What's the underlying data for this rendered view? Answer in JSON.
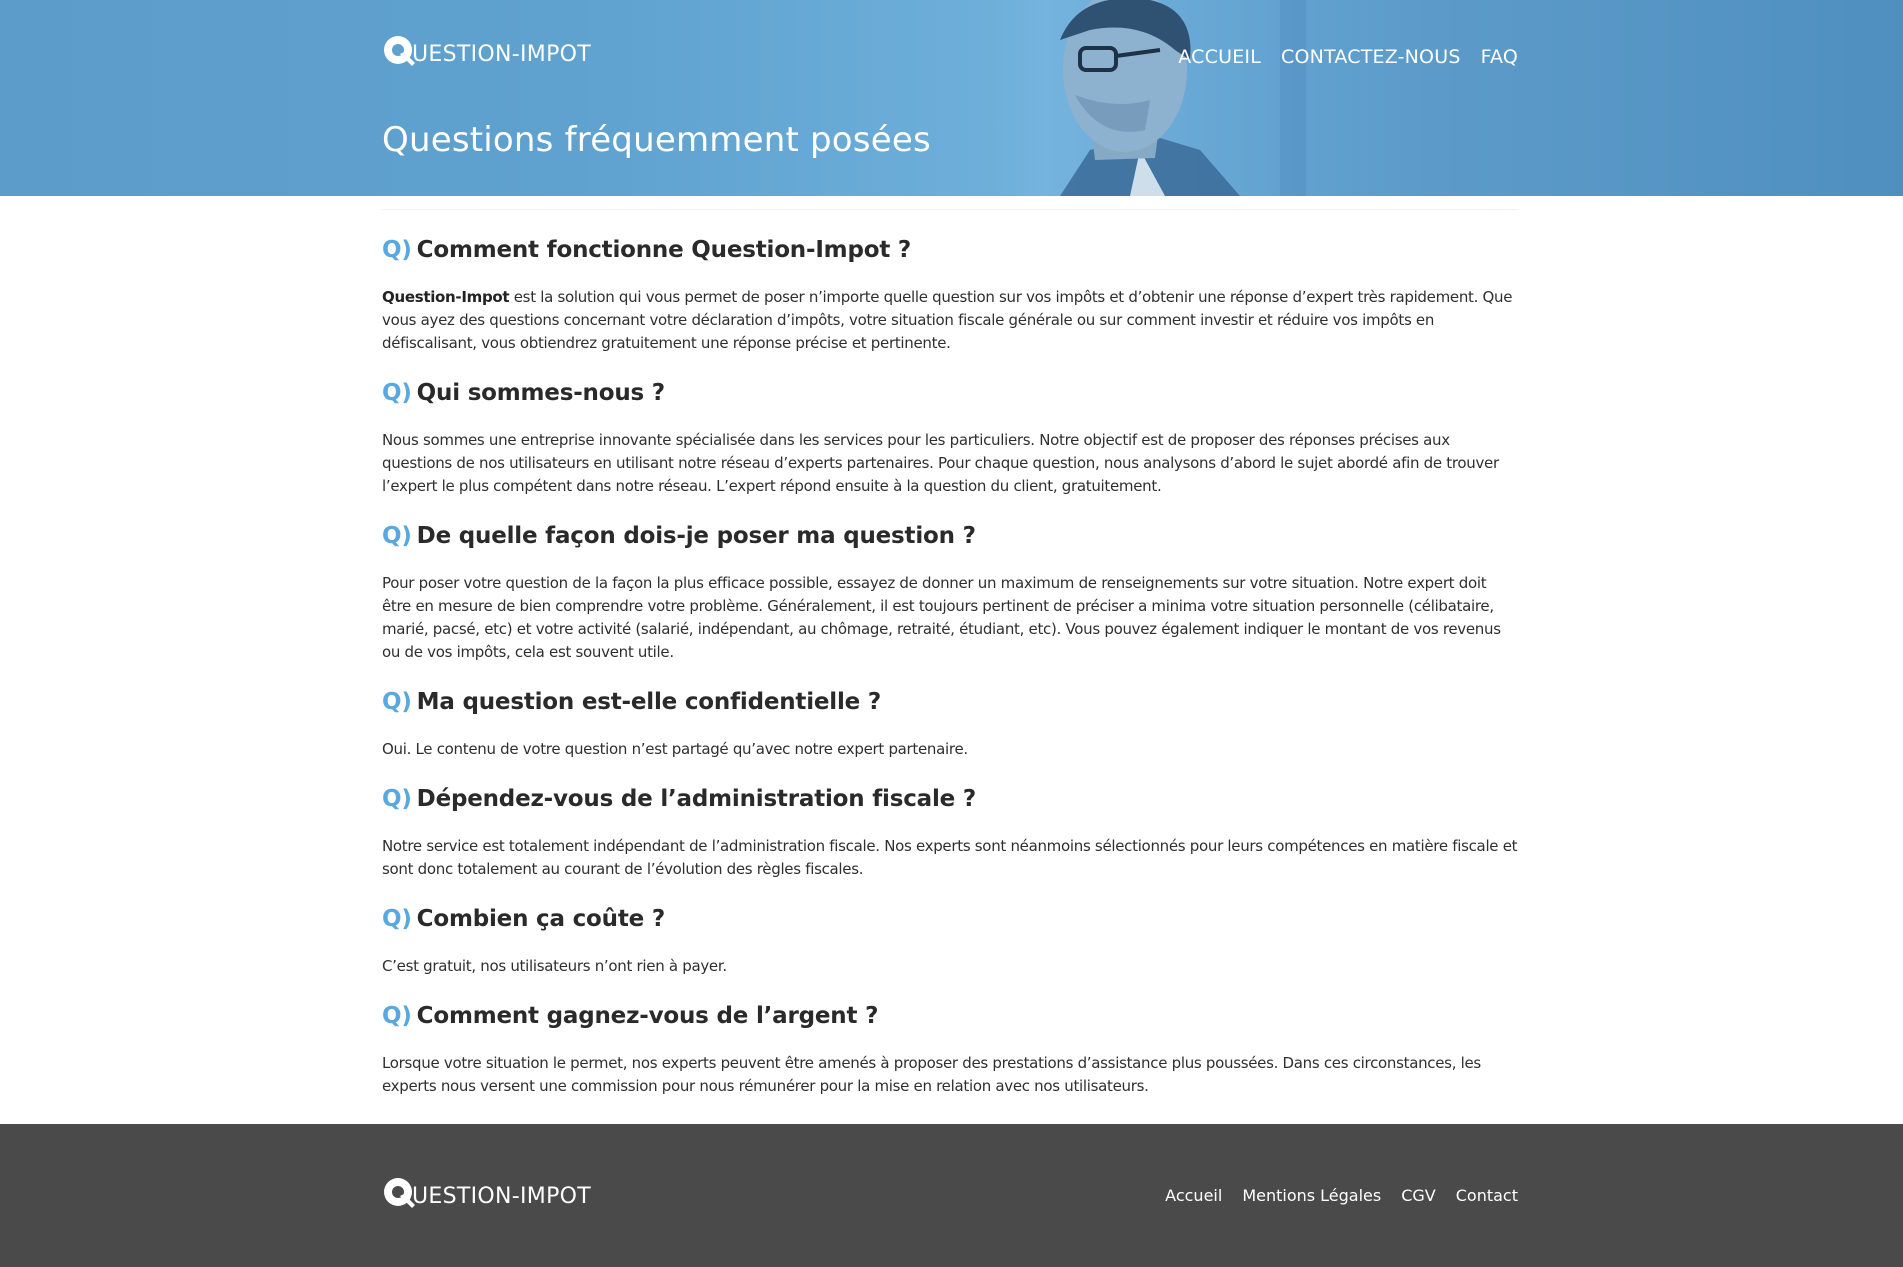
{
  "brand": {
    "logo_letter": "Q",
    "logo_text": "UESTION-IMPOT",
    "accent_color": "#5aa8e0",
    "header_color": "#5fa1cf",
    "footer_color": "#4a4a4a"
  },
  "nav": {
    "items": [
      "ACCUEIL",
      "CONTACTEZ-NOUS",
      "FAQ"
    ]
  },
  "page_title": "Questions fréquemment posées",
  "faq_prefix": "Q)",
  "faq": [
    {
      "question": "Comment fonctionne Question-Impot ?",
      "answer_strong": "Question-Impot",
      "answer": " est la solution qui vous permet de poser n’importe quelle question sur vos impôts et d’obtenir une réponse d’expert très rapidement. Que vous ayez des questions concernant votre déclaration d’impôts, votre situation fiscale générale ou sur comment investir et réduire vos impôts en défiscalisant, vous obtiendrez gratuitement une réponse précise et pertinente."
    },
    {
      "question": "Qui sommes-nous ?",
      "answer": "Nous sommes une entreprise innovante spécialisée dans les services pour les particuliers. Notre objectif est de proposer des réponses précises aux questions de nos utilisateurs en utilisant notre réseau d’experts partenaires. Pour chaque question, nous analysons d’abord le sujet abordé afin de trouver l’expert le plus compétent dans notre réseau. L’expert répond ensuite à la question du client, gratuitement."
    },
    {
      "question": "De quelle façon dois-je poser ma question ?",
      "answer": "Pour poser votre question de la façon la plus efficace possible, essayez de donner un maximum de renseignements sur votre situation. Notre expert doit être en mesure de bien comprendre votre problème. Généralement, il est toujours pertinent de préciser a minima votre situation personnelle (célibataire, marié, pacsé, etc) et votre activité (salarié, indépendant, au chômage, retraité, étudiant, etc). Vous pouvez également indiquer le montant de vos revenus ou de vos impôts, cela est souvent utile."
    },
    {
      "question": "Ma question est-elle confidentielle ?",
      "answer": "Oui. Le contenu de votre question n’est partagé qu’avec notre expert partenaire."
    },
    {
      "question": "Dépendez-vous de l’administration fiscale ?",
      "answer": "Notre service est totalement indépendant de l’administration fiscale. Nos experts sont néanmoins sélectionnés pour leurs compétences en matière fiscale et sont donc totalement au courant de l’évolution des règles fiscales."
    },
    {
      "question": "Combien ça coûte ?",
      "answer": "C’est gratuit, nos utilisateurs n’ont rien à payer."
    },
    {
      "question": "Comment gagnez-vous de l’argent ?",
      "answer": "Lorsque votre situation le permet, nos experts peuvent être amenés à proposer des prestations d’assistance plus poussées. Dans ces circonstances, les experts nous versent une commission pour nous rémunérer pour la mise en relation avec nos utilisateurs."
    }
  ],
  "footer": {
    "links": [
      "Accueil",
      "Mentions Légales",
      "CGV",
      "Contact"
    ]
  }
}
